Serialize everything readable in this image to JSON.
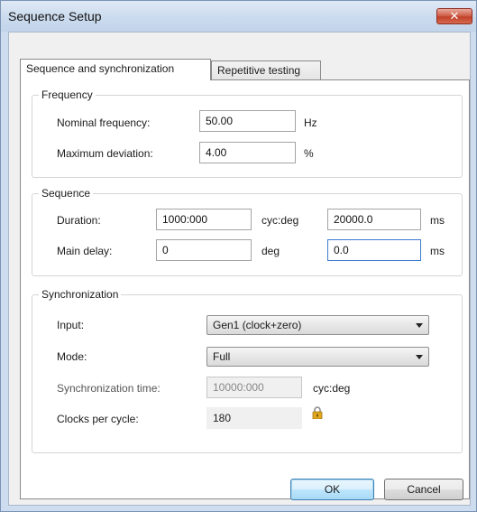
{
  "window": {
    "title": "Sequence Setup",
    "close_glyph": "✕"
  },
  "tabs": [
    {
      "label": "Sequence and synchronization",
      "active": true
    },
    {
      "label": "Repetitive testing",
      "active": false
    }
  ],
  "frequency": {
    "title": "Frequency",
    "nominal": {
      "label": "Nominal frequency:",
      "value": "50.00",
      "unit": "Hz"
    },
    "max_deviation": {
      "label": "Maximum deviation:",
      "value": "4.00",
      "unit": "%"
    }
  },
  "sequence": {
    "title": "Sequence",
    "duration": {
      "label": "Duration:",
      "value": "1000:000",
      "unit": "cyc:deg",
      "ms_value": "20000.0",
      "ms_unit": "ms"
    },
    "main_delay": {
      "label": "Main delay:",
      "value": "0",
      "unit": "deg",
      "ms_value": "0.0",
      "ms_unit": "ms"
    }
  },
  "synchronization": {
    "title": "Synchronization",
    "input": {
      "label": "Input:",
      "value": "Gen1 (clock+zero)"
    },
    "mode": {
      "label": "Mode:",
      "value": "Full"
    },
    "sync_time": {
      "label": "Synchronization time:",
      "value": "10000:000",
      "unit": "cyc:deg"
    },
    "clocks_per_cycle": {
      "label": "Clocks per cycle:",
      "value": "180"
    }
  },
  "buttons": {
    "ok": "OK",
    "cancel": "Cancel"
  },
  "icons": {
    "close": "close-icon",
    "dropdown": "chevron-down-icon",
    "lock": "lock-icon"
  },
  "colors": {
    "title_bar": "#cbdbee",
    "close_button": "#c94a33",
    "focus_border": "#3d7bcd",
    "lock_gold": "#e0a820"
  }
}
